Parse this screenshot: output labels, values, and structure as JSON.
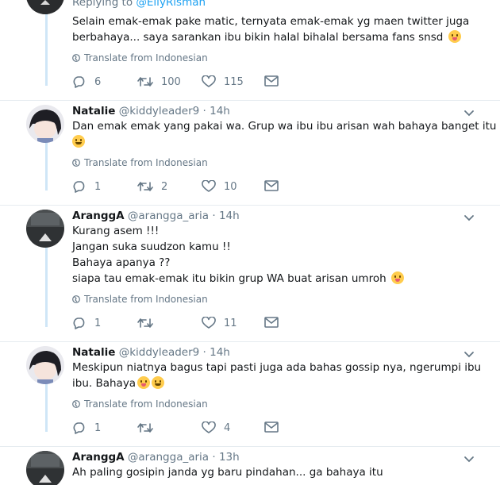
{
  "colors": {
    "link": "#1da1f2",
    "muted": "#657786",
    "text": "#14171a",
    "thread_line": "#cfe6f7",
    "divider": "#e6ecf0"
  },
  "icons": [
    "reply-icon",
    "retweet-icon",
    "like-icon",
    "message-icon",
    "globe-icon",
    "chevron-down-icon",
    "emoji-icon"
  ],
  "tweets": [
    {
      "replying_label": "Replying to",
      "replying_handle": "@EllyRisman",
      "lines": [
        "Selain emak-emak pake matic, ternyata emak-emak yg maen twitter juga",
        "berbahaya... saya sarankan ibu bikin halal bihalal bersama fans snsd"
      ],
      "translate": "Translate from Indonesian",
      "replies": "6",
      "retweets": "100",
      "likes": "115"
    },
    {
      "name": "Natalie",
      "handle": "@kiddyleader9",
      "time": "· 14h",
      "lines": [
        "Dan emak emak yang pakai wa. Grup wa ibu ibu arisan wah bahaya banget itu"
      ],
      "translate": "Translate from Indonesian",
      "replies": "1",
      "retweets": "2",
      "likes": "10"
    },
    {
      "name": "AranggA",
      "handle": "@arangga_aria",
      "time": "· 14h",
      "lines": [
        "Kurang asem !!!",
        "Jangan suka suudzon kamu !!",
        "Bahaya apanya ??",
        "siapa tau emak-emak itu bikin grup WA buat arisan umroh"
      ],
      "translate": "Translate from Indonesian",
      "replies": "1",
      "retweets": "",
      "likes": "11"
    },
    {
      "name": "Natalie",
      "handle": "@kiddyleader9",
      "time": "· 14h",
      "lines": [
        "Meskipun niatnya bagus tapi pasti juga ada bahas gossip nya, ngerumpi ibu",
        "ibu. Bahaya"
      ],
      "translate": "Translate from Indonesian",
      "replies": "1",
      "retweets": "",
      "likes": "4"
    },
    {
      "name": "AranggA",
      "handle": "@arangga_aria",
      "time": "· 13h",
      "lines": [
        "Ah paling gosipin janda yg baru pindahan... ga bahaya itu"
      ]
    }
  ]
}
